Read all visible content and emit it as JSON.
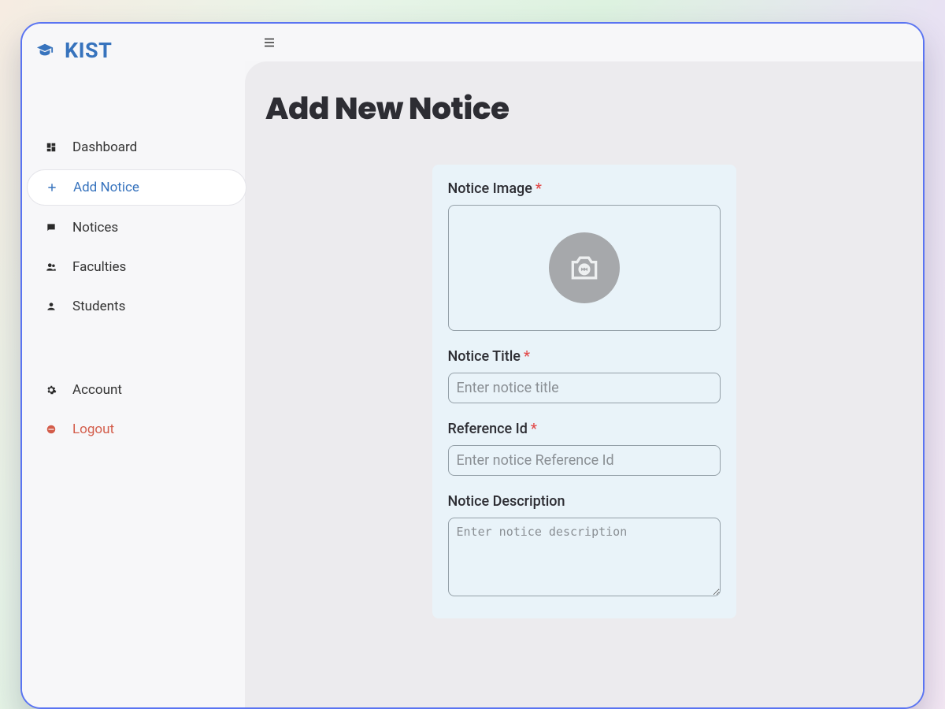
{
  "brand": {
    "name": "KIST"
  },
  "sidebar": {
    "items": [
      {
        "label": "Dashboard"
      },
      {
        "label": "Add Notice"
      },
      {
        "label": "Notices"
      },
      {
        "label": "Faculties"
      },
      {
        "label": "Students"
      },
      {
        "label": "Account"
      },
      {
        "label": "Logout"
      }
    ]
  },
  "page": {
    "title": "Add New Notice"
  },
  "form": {
    "image_label": "Notice Image",
    "title_label": "Notice Title",
    "title_placeholder": "Enter notice title",
    "ref_label": "Reference Id",
    "ref_placeholder": "Enter notice Reference Id",
    "desc_label": "Notice Description",
    "desc_placeholder": "Enter notice description",
    "required_mark": "*"
  }
}
